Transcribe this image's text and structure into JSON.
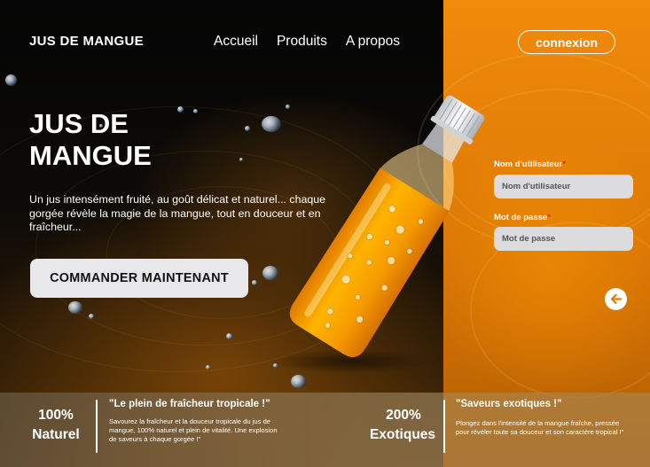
{
  "brand": "JUS DE MANGUE",
  "nav": {
    "home": "Accueil",
    "products": "Produits",
    "about": "A propos"
  },
  "login_button": "connexion",
  "hero": {
    "title": "JUS DE MANGUE",
    "text": "Un jus intensément fruité, au goût délicat et naturel... chaque gorgée révèle la magie de la mangue, tout en douceur et en fraîcheur...",
    "cta": "COMMANDER MAINTENANT"
  },
  "form": {
    "username_label": "Nom d'utilisateur",
    "username_placeholder": "Nom d'utilisateur",
    "password_label": "Mot de passe",
    "password_placeholder": "Mot de passe",
    "required_mark": "*"
  },
  "stats": [
    {
      "value": "100%",
      "label": "Naturel",
      "title": "\"Le plein de fraîcheur tropicale !\"",
      "text": "Savourez la fraîcheur et la douceur tropicale du jus de mangue, 100% naturel et plein de vitalité.  Une explosion de saveurs à chaque gorgée !\""
    },
    {
      "value": "200%",
      "label": "Exotiques",
      "title": "\"Saveurs exotiques !\"",
      "text": "Plongez dans l'intensité de la mangue fraîche, pressée pour révéler toute sa douceur et son caractère tropical !\""
    }
  ],
  "colors": {
    "accent": "#f28a0a",
    "juice": "#f5a000",
    "input_bg": "#dcdcde",
    "required": "#e0261a"
  },
  "icons": {
    "back": "arrow-left-icon"
  }
}
